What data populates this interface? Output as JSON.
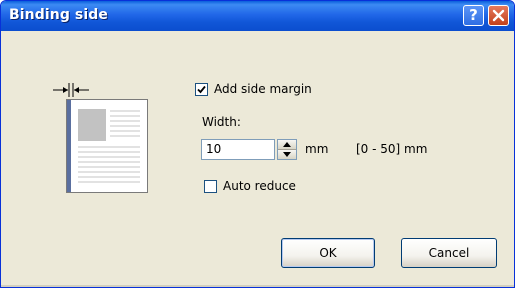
{
  "dialog": {
    "title": "Binding side",
    "help_icon": "help-icon",
    "close_icon": "close-icon"
  },
  "options": {
    "add_side_margin": {
      "label": "Add side margin",
      "checked": true
    },
    "width": {
      "label": "Width:",
      "value": "10",
      "unit": "mm",
      "range": "[0 - 50] mm"
    },
    "auto_reduce": {
      "label": "Auto reduce",
      "checked": false
    }
  },
  "buttons": {
    "ok": "OK",
    "cancel": "Cancel"
  },
  "colors": {
    "title_bar": "#2167e8",
    "dialog_bg": "#ece9d8",
    "close_button": "#c2401a"
  }
}
